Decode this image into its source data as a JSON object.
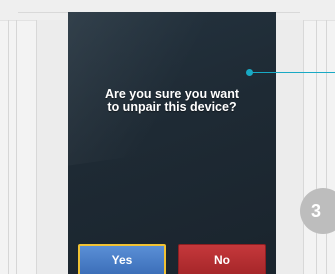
{
  "screen": {
    "message": "Are you sure you want\nto unpair this device?",
    "buttons": {
      "yes_label": "Yes",
      "no_label": "No"
    }
  },
  "annotation": {
    "step_number": "3"
  },
  "colors": {
    "screen_background": "#1e2a34",
    "yes_button": "#4a7fc8",
    "yes_button_border": "#f0c234",
    "no_button": "#b52f32",
    "callout": "#18a9c4",
    "step_badge": "#bdbdbd"
  }
}
